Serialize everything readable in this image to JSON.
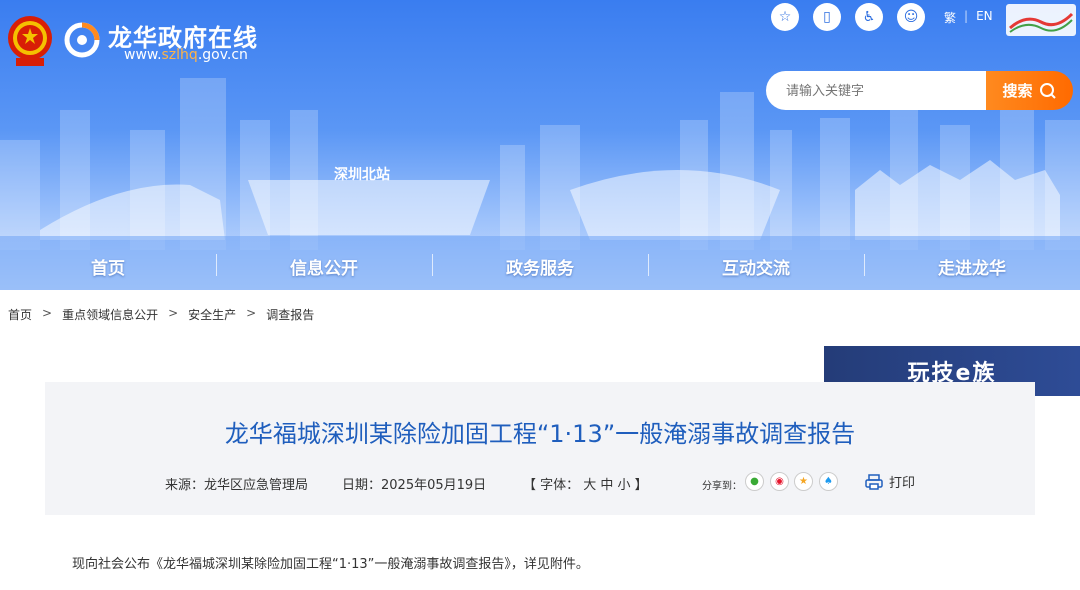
{
  "header": {
    "site_title": "龙华政府在线",
    "url_prefix": "www.",
    "url_highlight": "szlhq",
    "url_suffix": ".gov.cn",
    "top_icons": [
      "star-icon",
      "mobile-icon",
      "accessibility-icon",
      "elderly-icon"
    ],
    "lang_trad": "繁",
    "lang_en": "EN",
    "search_placeholder": "请输入关键字",
    "search_label": "搜索",
    "station_label": "深圳北站"
  },
  "nav": [
    "首页",
    "信息公开",
    "政务服务",
    "互动交流",
    "走进龙华"
  ],
  "breadcrumb": [
    "首页",
    "重点领域信息公开",
    "安全生产",
    "调查报告"
  ],
  "watermark": "玩技e族",
  "article": {
    "title": "龙华福城深圳某除险加固工程“1·13”一般淹溺事故调查报告",
    "source": "来源：龙华区应急管理局",
    "date": "日期：2025年05月19日",
    "font_label": "【 字体：  大  中  小  】",
    "share_label": "分享到：",
    "print_label": "打印",
    "body": "现向社会公布《龙华福城深圳某除险加固工程“1·13”一般淹溺事故调查报告》，详见附件。"
  },
  "colors": {
    "title_blue": "#1f5ebd",
    "search_orange": "#ff7a10",
    "banner_blue": "#3a7df0"
  }
}
